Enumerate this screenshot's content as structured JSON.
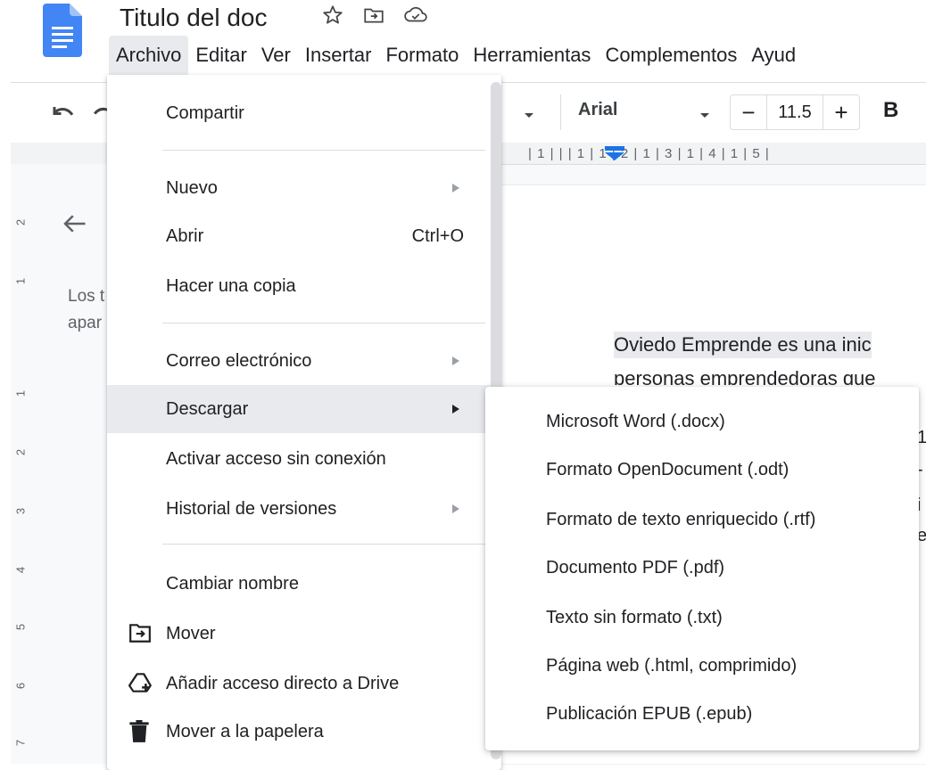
{
  "header": {
    "title": "Titulo del doc",
    "menubar": [
      "Archivo",
      "Editar",
      "Ver",
      "Insertar",
      "Formato",
      "Herramientas",
      "Complementos",
      "Ayud"
    ]
  },
  "toolbar": {
    "font": "Arial",
    "font_size": "11.5",
    "decrease": "−",
    "increase": "+",
    "bold": "B"
  },
  "ruler": {
    "horizontal": "| 1 | |    | 1 | 1 | 2 | 1 | 3 | 1 | 4 | 1 | 5 |",
    "vertical_numbers": [
      "2",
      "1",
      "1",
      "2",
      "3",
      "4",
      "5",
      "6",
      "7"
    ]
  },
  "outline": {
    "text_line1": "Los t",
    "text_line2": "apar"
  },
  "document": {
    "line1": "Oviedo Emprende es una inic",
    "line2": "personas emprendedoras que",
    "fragments": [
      "1",
      "-",
      "i",
      "e"
    ]
  },
  "file_menu": {
    "share": "Compartir",
    "new": "Nuevo",
    "open": "Abrir",
    "open_shortcut": "Ctrl+O",
    "make_copy": "Hacer una copia",
    "email": "Correo electrónico",
    "download": "Descargar",
    "offline": "Activar acceso sin conexión",
    "version_history": "Historial de versiones",
    "rename": "Cambiar nombre",
    "move": "Mover",
    "add_shortcut": "Añadir acceso directo a Drive",
    "trash": "Mover a la papelera"
  },
  "download_submenu": [
    "Microsoft Word (.docx)",
    "Formato OpenDocument (.odt)",
    "Formato de texto enriquecido (.rtf)",
    "Documento PDF (.pdf)",
    "Texto sin formato (.txt)",
    "Página web (.html, comprimido)",
    "Publicación EPUB (.epub)"
  ],
  "colors": {
    "docs_blue": "#4285f4",
    "menu_hover": "#e8eaed",
    "ruler_marker": "#1a73e8"
  }
}
